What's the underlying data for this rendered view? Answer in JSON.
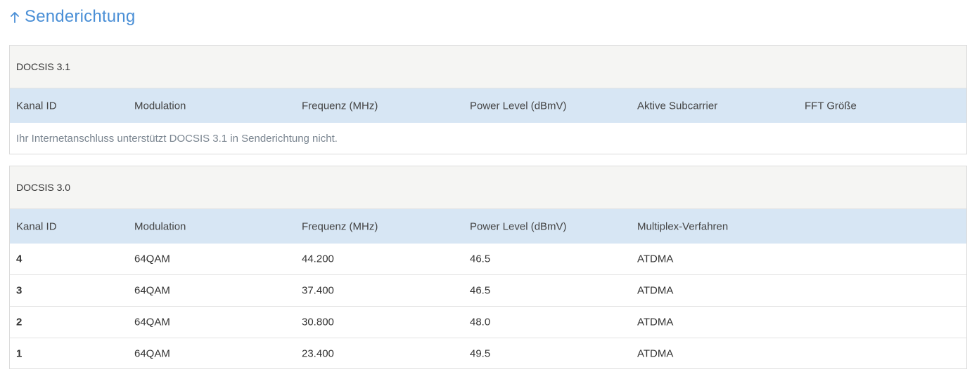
{
  "section": {
    "title": "Senderichtung",
    "icon": "arrow-up-icon",
    "accent_color": "#4a8fd6"
  },
  "docsis31": {
    "title": "DOCSIS 3.1",
    "columns": [
      "Kanal ID",
      "Modulation",
      "Frequenz (MHz)",
      "Power Level (dBmV)",
      "Aktive Subcarrier",
      "FFT Größe"
    ],
    "message": "Ihr Internetanschluss unterstützt DOCSIS 3.1 in Senderichtung nicht."
  },
  "docsis30": {
    "title": "DOCSIS 3.0",
    "columns": [
      "Kanal ID",
      "Modulation",
      "Frequenz (MHz)",
      "Power Level (dBmV)",
      "Multiplex-Verfahren"
    ],
    "rows": [
      {
        "kanal": "4",
        "modulation": "64QAM",
        "frequenz": "44.200",
        "power": "46.5",
        "multiplex": "ATDMA"
      },
      {
        "kanal": "3",
        "modulation": "64QAM",
        "frequenz": "37.400",
        "power": "46.5",
        "multiplex": "ATDMA"
      },
      {
        "kanal": "2",
        "modulation": "64QAM",
        "frequenz": "30.800",
        "power": "48.0",
        "multiplex": "ATDMA"
      },
      {
        "kanal": "1",
        "modulation": "64QAM",
        "frequenz": "23.400",
        "power": "49.5",
        "multiplex": "ATDMA"
      }
    ]
  }
}
